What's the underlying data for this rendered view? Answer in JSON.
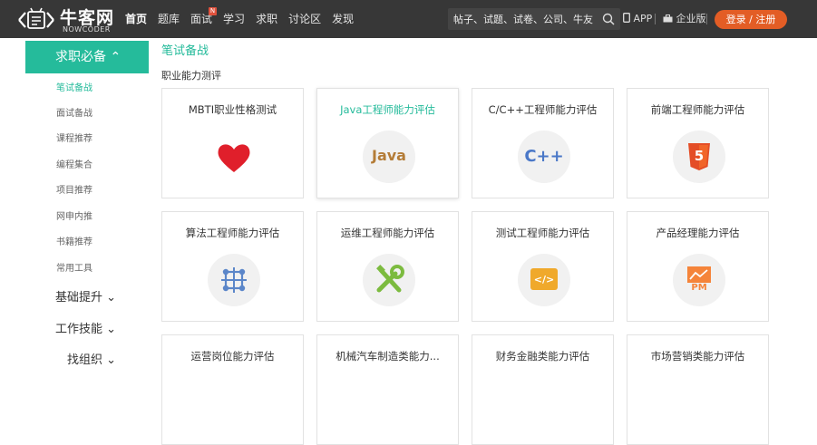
{
  "logo": {
    "name_cn": "牛客网",
    "name_en": "NOWCODER"
  },
  "nav": {
    "items": [
      {
        "label": "首页",
        "active": true
      },
      {
        "label": "题库"
      },
      {
        "label": "面试",
        "badge": "N"
      },
      {
        "label": "学习"
      },
      {
        "label": "求职"
      },
      {
        "label": "讨论区"
      },
      {
        "label": "发现"
      }
    ],
    "search_placeholder": "帖子、试题、试卷、公司、牛友",
    "app_label": "APP",
    "enterprise_label": "企业版",
    "login_label": "登录 / 注册"
  },
  "sidebar": {
    "header": "求职必备 ⌃",
    "items": [
      "笔试备战",
      "面试备战",
      "课程推荐",
      "编程集合",
      "项目推荐",
      "网申内推",
      "书籍推荐",
      "常用工具"
    ],
    "groups": [
      "基础提升 ⌄",
      "工作技能 ⌄",
      "找组织 ⌄"
    ]
  },
  "main": {
    "breadcrumb": "笔试备战",
    "section_title": "职业能力测评",
    "cards": [
      {
        "title": "MBTI职业性格测试",
        "icon": "heart-icon",
        "color": "#e01f2b"
      },
      {
        "title": "Java工程师能力评估",
        "icon": "java-icon",
        "icon_text": "Java",
        "color": "#b47c37"
      },
      {
        "title": "C/C++工程师能力评估",
        "icon": "cpp-icon",
        "icon_text": "C++",
        "color": "#4a78c8"
      },
      {
        "title": "前端工程师能力评估",
        "icon": "html5-icon",
        "icon_text": "5",
        "color": "#e44d26"
      },
      {
        "title": "算法工程师能力评估",
        "icon": "algorithm-icon",
        "color": "#5b86c9"
      },
      {
        "title": "运维工程师能力评估",
        "icon": "wrench-icon",
        "color": "#7cbb3f"
      },
      {
        "title": "测试工程师能力评估",
        "icon": "code-icon",
        "icon_text": "</>",
        "color": "#f0a92b"
      },
      {
        "title": "产品经理能力评估",
        "icon": "pm-icon",
        "icon_text": "PM",
        "color": "#f5843a"
      },
      {
        "title": "运营岗位能力评估"
      },
      {
        "title": "机械汽车制造类能力..."
      },
      {
        "title": "财务金融类能力评估"
      },
      {
        "title": "市场营销类能力评估"
      }
    ]
  }
}
